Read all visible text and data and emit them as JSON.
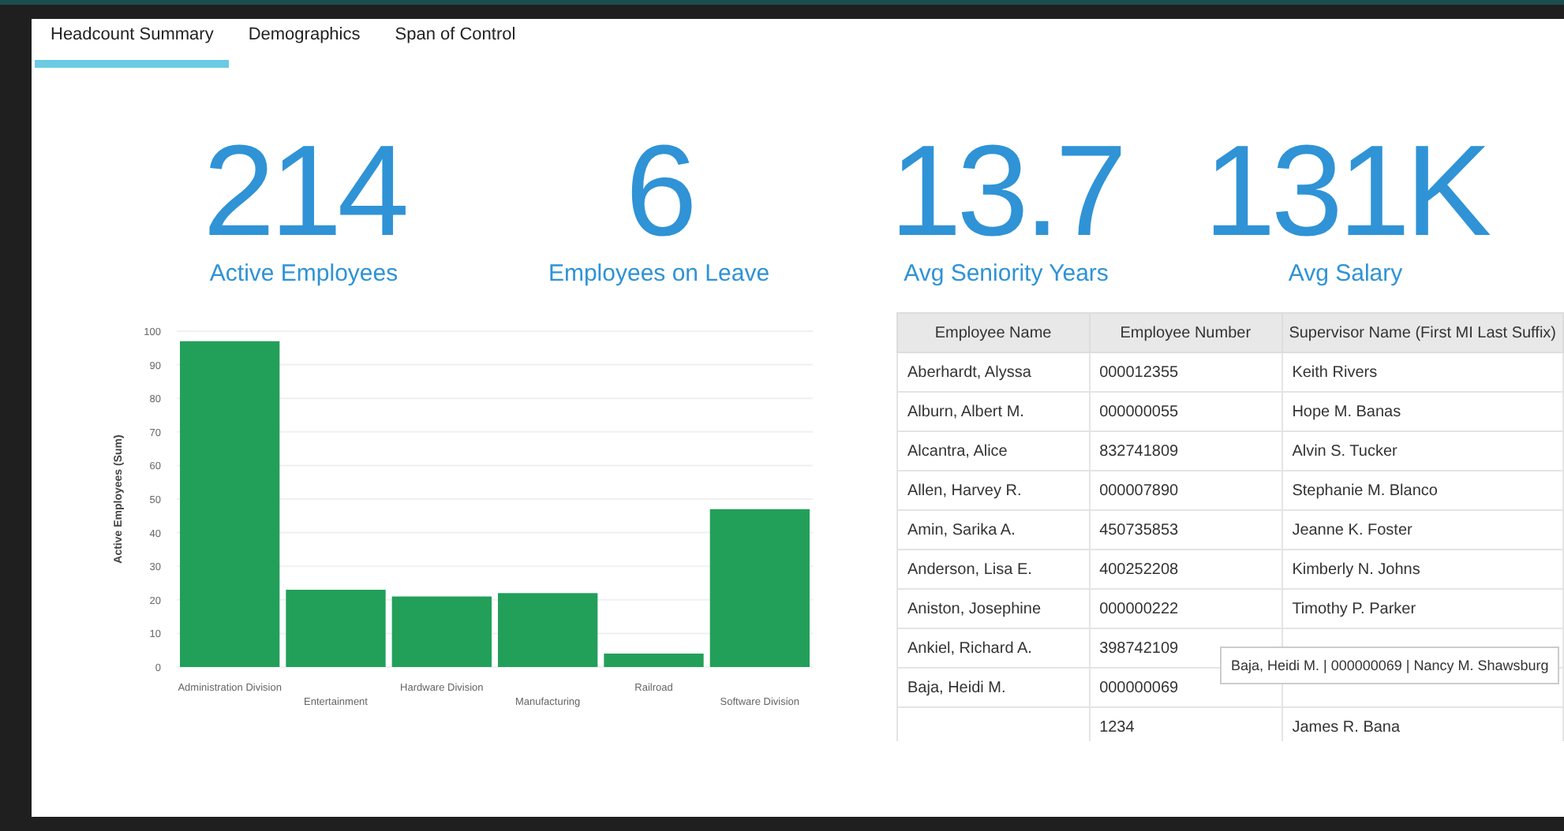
{
  "tabs": [
    {
      "label": "Headcount Summary",
      "selected": true
    },
    {
      "label": "Demographics",
      "selected": false
    },
    {
      "label": "Span of Control",
      "selected": false
    }
  ],
  "kpis": [
    {
      "value": "214",
      "label": "Active Employees"
    },
    {
      "value": "6",
      "label": "Employees on Leave"
    },
    {
      "value": "13.7",
      "label": "Avg Seniority Years"
    },
    {
      "value": "131K",
      "label": "Avg Salary"
    }
  ],
  "chart": {
    "chart_data": {
      "type": "bar",
      "ylabel": "Active Employees (Sum)",
      "categories": [
        "Administration Division",
        "Entertainment",
        "Hardware Division",
        "Manufacturing",
        "Railroad",
        "Software Division"
      ],
      "series": [
        {
          "color": "#22a05a",
          "values": [
            97,
            23,
            21,
            22,
            4,
            47
          ]
        }
      ],
      "grid": true,
      "ylim": [
        0,
        100
      ],
      "yticks": [
        0,
        10,
        20,
        30,
        40,
        50,
        60,
        70,
        80,
        90,
        100
      ]
    }
  },
  "table": {
    "columns": [
      "Employee Name",
      "Employee Number",
      "Supervisor Name (First MI Last Suffix)"
    ],
    "rows": [
      {
        "employee_name": "Aberhardt, Alyssa",
        "employee_number": "000012355",
        "supervisor_name": "Keith Rivers"
      },
      {
        "employee_name": "Alburn, Albert M.",
        "employee_number": "000000055",
        "supervisor_name": "Hope M. Banas"
      },
      {
        "employee_name": "Alcantra, Alice",
        "employee_number": "832741809",
        "supervisor_name": "Alvin S. Tucker"
      },
      {
        "employee_name": "Allen, Harvey R.",
        "employee_number": "000007890",
        "supervisor_name": "Stephanie M. Blanco"
      },
      {
        "employee_name": "Amin, Sarika A.",
        "employee_number": "450735853",
        "supervisor_name": "Jeanne K. Foster"
      },
      {
        "employee_name": "Anderson, Lisa E.",
        "employee_number": "400252208",
        "supervisor_name": "Kimberly N. Johns"
      },
      {
        "employee_name": "Aniston, Josephine",
        "employee_number": "000000222",
        "supervisor_name": "Timothy P. Parker"
      },
      {
        "employee_name": "Ankiel, Richard A.",
        "employee_number": "398742109"
      },
      {
        "employee_name": "Baja, Heidi M.",
        "employee_number": "000000069"
      },
      {
        "employee_number": "1234",
        "supervisor_name": "James R. Bana"
      }
    ],
    "tooltip": "Baja, Heidi M. | 000000069 | Nancy M. Shawsburg"
  }
}
